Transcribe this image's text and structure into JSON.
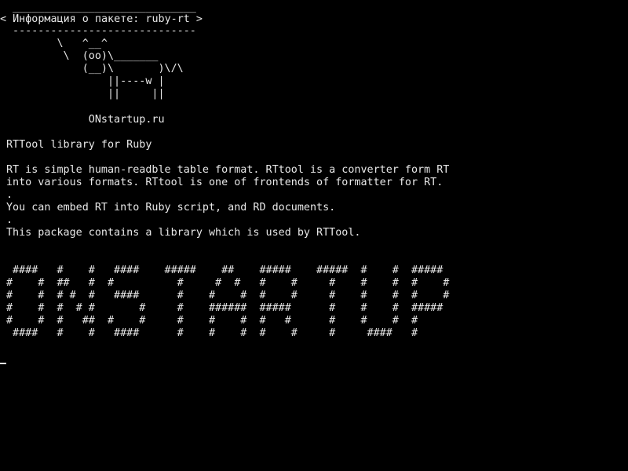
{
  "terminal": {
    "cowsay": {
      "bubble_top": " _____________________________",
      "bubble_text": "< Информация о пакете: ruby-rt >",
      "bubble_bottom": " -----------------------------",
      "cow_1": "        \\   ^__^",
      "cow_2": "         \\  (oo)\\_______",
      "cow_3": "            (__)\\       )\\/\\",
      "cow_4": "                ||----w |",
      "cow_5": "                ||     ||",
      "site": "             ONstartup.ru"
    },
    "package": {
      "summary": "RTTool library for Ruby",
      "desc_line_1": "RT is simple human-readble table format. RTtool is a converter form RT",
      "desc_line_2": "into various formats. RTtool is one of frontends of formatter for RT.",
      "dot_1": ".",
      "desc_line_3": "You can embed RT into Ruby script, and RD documents.",
      "dot_2": ".",
      "desc_line_4": "This package contains a library which is used by RTTool."
    },
    "banner": {
      "line_1": " ####   #    #   ####    #####    ##    #####    #####  #    #  #####",
      "line_2": "#    #  ##   #  #          #     #  #   #    #     #    #    #  #    #",
      "line_3": "#    #  # #  #   ####      #    #    #  #    #     #    #    #  #    #",
      "line_4": "#    #  #  # #       #     #    ######  #####      #    #    #  #####",
      "line_5": "#    #  #   ##  #    #     #    #    #  #   #      #    #    #  #",
      "line_6": " ####   #    #   ####      #    #    #  #    #     #     ####   #"
    }
  }
}
